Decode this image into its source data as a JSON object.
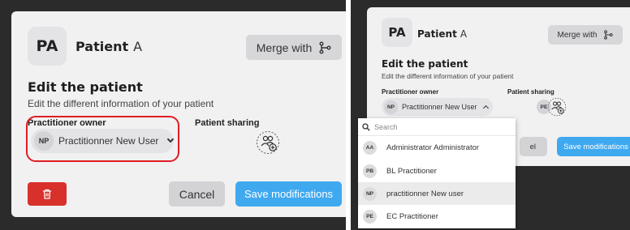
{
  "left": {
    "patient": {
      "initials": "PA",
      "name_bold": "Patient",
      "name_regular": "A"
    },
    "merge_label": "Merge with",
    "edit_title": "Edit the patient",
    "edit_subtitle": "Edit the different information of your patient",
    "owner_label": "Practitioner owner",
    "owner_value": {
      "initials": "NP",
      "name": "Practitionner New User"
    },
    "sharing_label": "Patient sharing",
    "cancel_label": "Cancel",
    "save_label": "Save modifications"
  },
  "right": {
    "patient": {
      "initials": "PA",
      "name_bold": "Patient",
      "name_regular": "A"
    },
    "merge_label": "Merge with",
    "edit_title": "Edit the patient",
    "edit_subtitle": "Edit the different information of your patient",
    "owner_label": "Practitioner owner",
    "owner_value": {
      "initials": "NP",
      "name": "Practitionner New User"
    },
    "sharing_label": "Patient sharing",
    "sharing_member_initials": "PE",
    "cancel_partial": "el",
    "save_label": "Save modifications",
    "dropdown": {
      "search_placeholder": "Search",
      "options": [
        {
          "initials": "AA",
          "name": "Administrator Administrator",
          "selected": false
        },
        {
          "initials": "PB",
          "name": "BL Practitioner",
          "selected": false
        },
        {
          "initials": "NP",
          "name": "practitionner New user",
          "selected": true
        },
        {
          "initials": "PE",
          "name": "EC Practitioner",
          "selected": false
        }
      ]
    }
  },
  "colors": {
    "primary": "#3fa9f0",
    "danger": "#d8302b",
    "highlight": "#e01e24",
    "surface": "#f1f1f2",
    "backdrop": "#2b2b2b"
  }
}
